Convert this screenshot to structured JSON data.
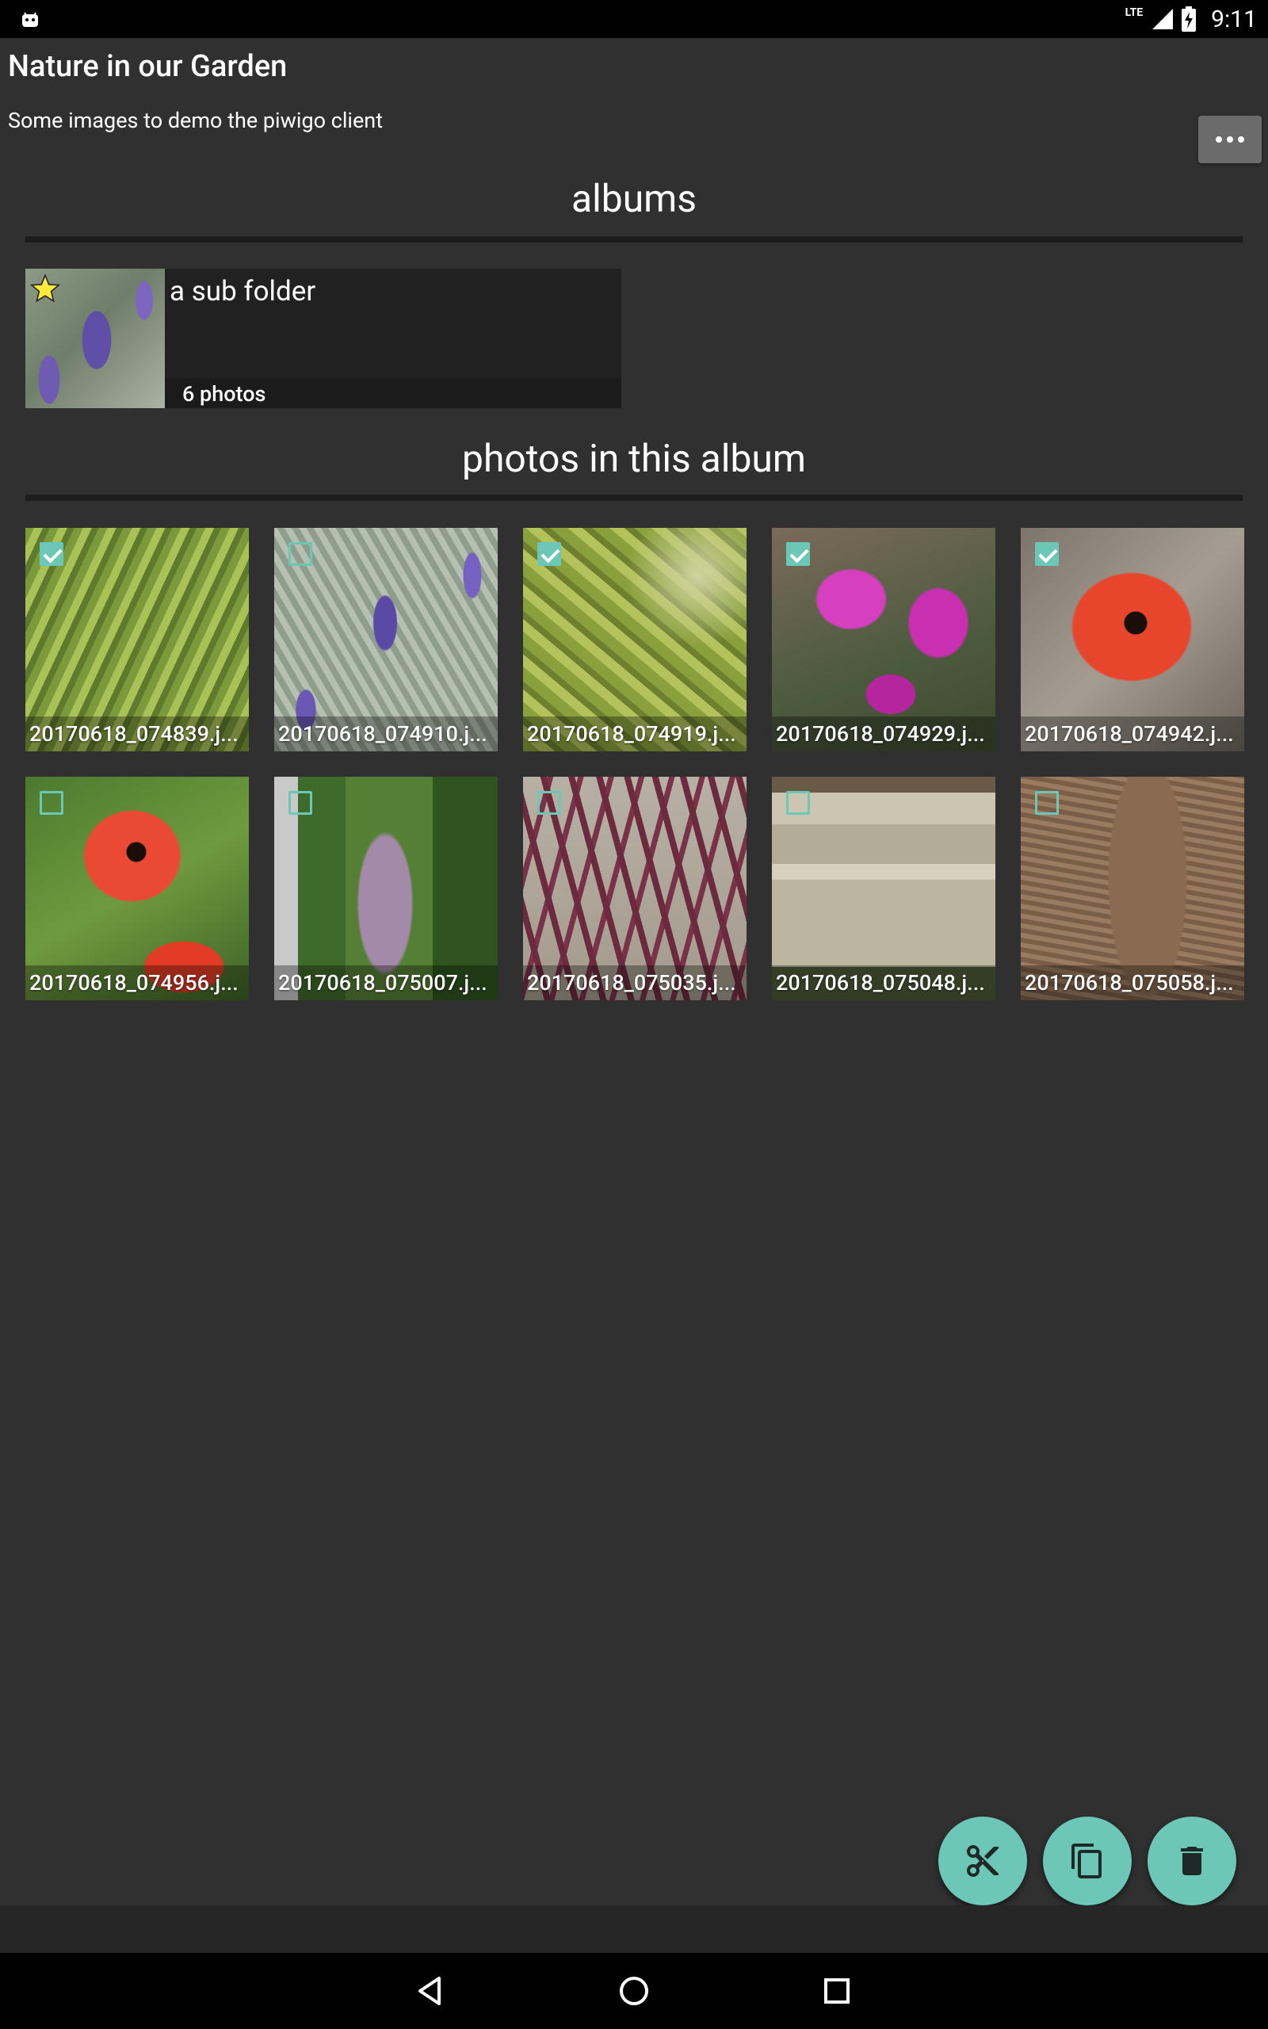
{
  "status_bar": {
    "network": "LTE",
    "time": "9:11"
  },
  "header": {
    "title": "Nature in our Garden",
    "subtitle": "Some images to demo the piwigo client",
    "more_icon": "more-horizontal-icon"
  },
  "albums_section": {
    "heading": "albums",
    "items": [
      {
        "name": "a sub folder",
        "count": "6 photos",
        "favorite": true
      }
    ]
  },
  "photos_section": {
    "heading": "photos in this album",
    "items": [
      {
        "caption": "20170618_074839.j...",
        "selected": true
      },
      {
        "caption": "20170618_074910.j...",
        "selected": false
      },
      {
        "caption": "20170618_074919.j...",
        "selected": true
      },
      {
        "caption": "20170618_074929.j...",
        "selected": true
      },
      {
        "caption": "20170618_074942.j...",
        "selected": true
      },
      {
        "caption": "20170618_074956.j...",
        "selected": false
      },
      {
        "caption": "20170618_075007.j...",
        "selected": false
      },
      {
        "caption": "20170618_075035.j...",
        "selected": false
      },
      {
        "caption": "20170618_075048.j...",
        "selected": false
      },
      {
        "caption": "20170618_075058.j...",
        "selected": false
      }
    ]
  },
  "actions": {
    "accent_color": "#6cc7b7",
    "buttons": [
      "cut-icon",
      "copy-icon",
      "delete-icon"
    ]
  },
  "nav_bar": [
    "back-icon",
    "home-icon",
    "recents-icon"
  ]
}
